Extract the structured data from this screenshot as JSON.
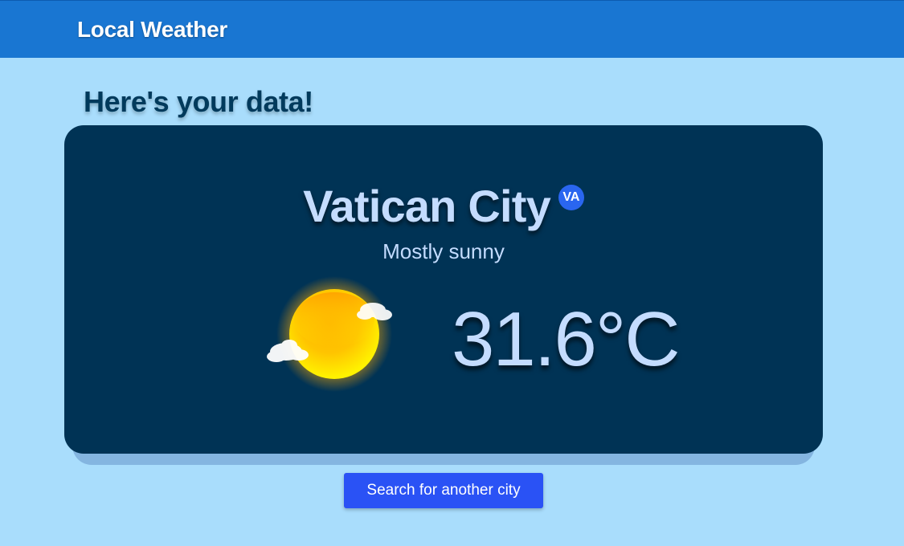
{
  "header": {
    "app_title": "Local Weather",
    "bar_color": "#1976d2"
  },
  "main": {
    "heading": "Here's your data!",
    "card": {
      "city": "Vatican City",
      "country_code": "VA",
      "condition": "Mostly sunny",
      "condition_icon": "sun-with-clouds-icon",
      "temperature": "31.6°C",
      "background_color": "#003355"
    },
    "search_button_label": "Search for another city",
    "accent_color": "#2a52f5",
    "page_background": "#a9ddfc"
  }
}
